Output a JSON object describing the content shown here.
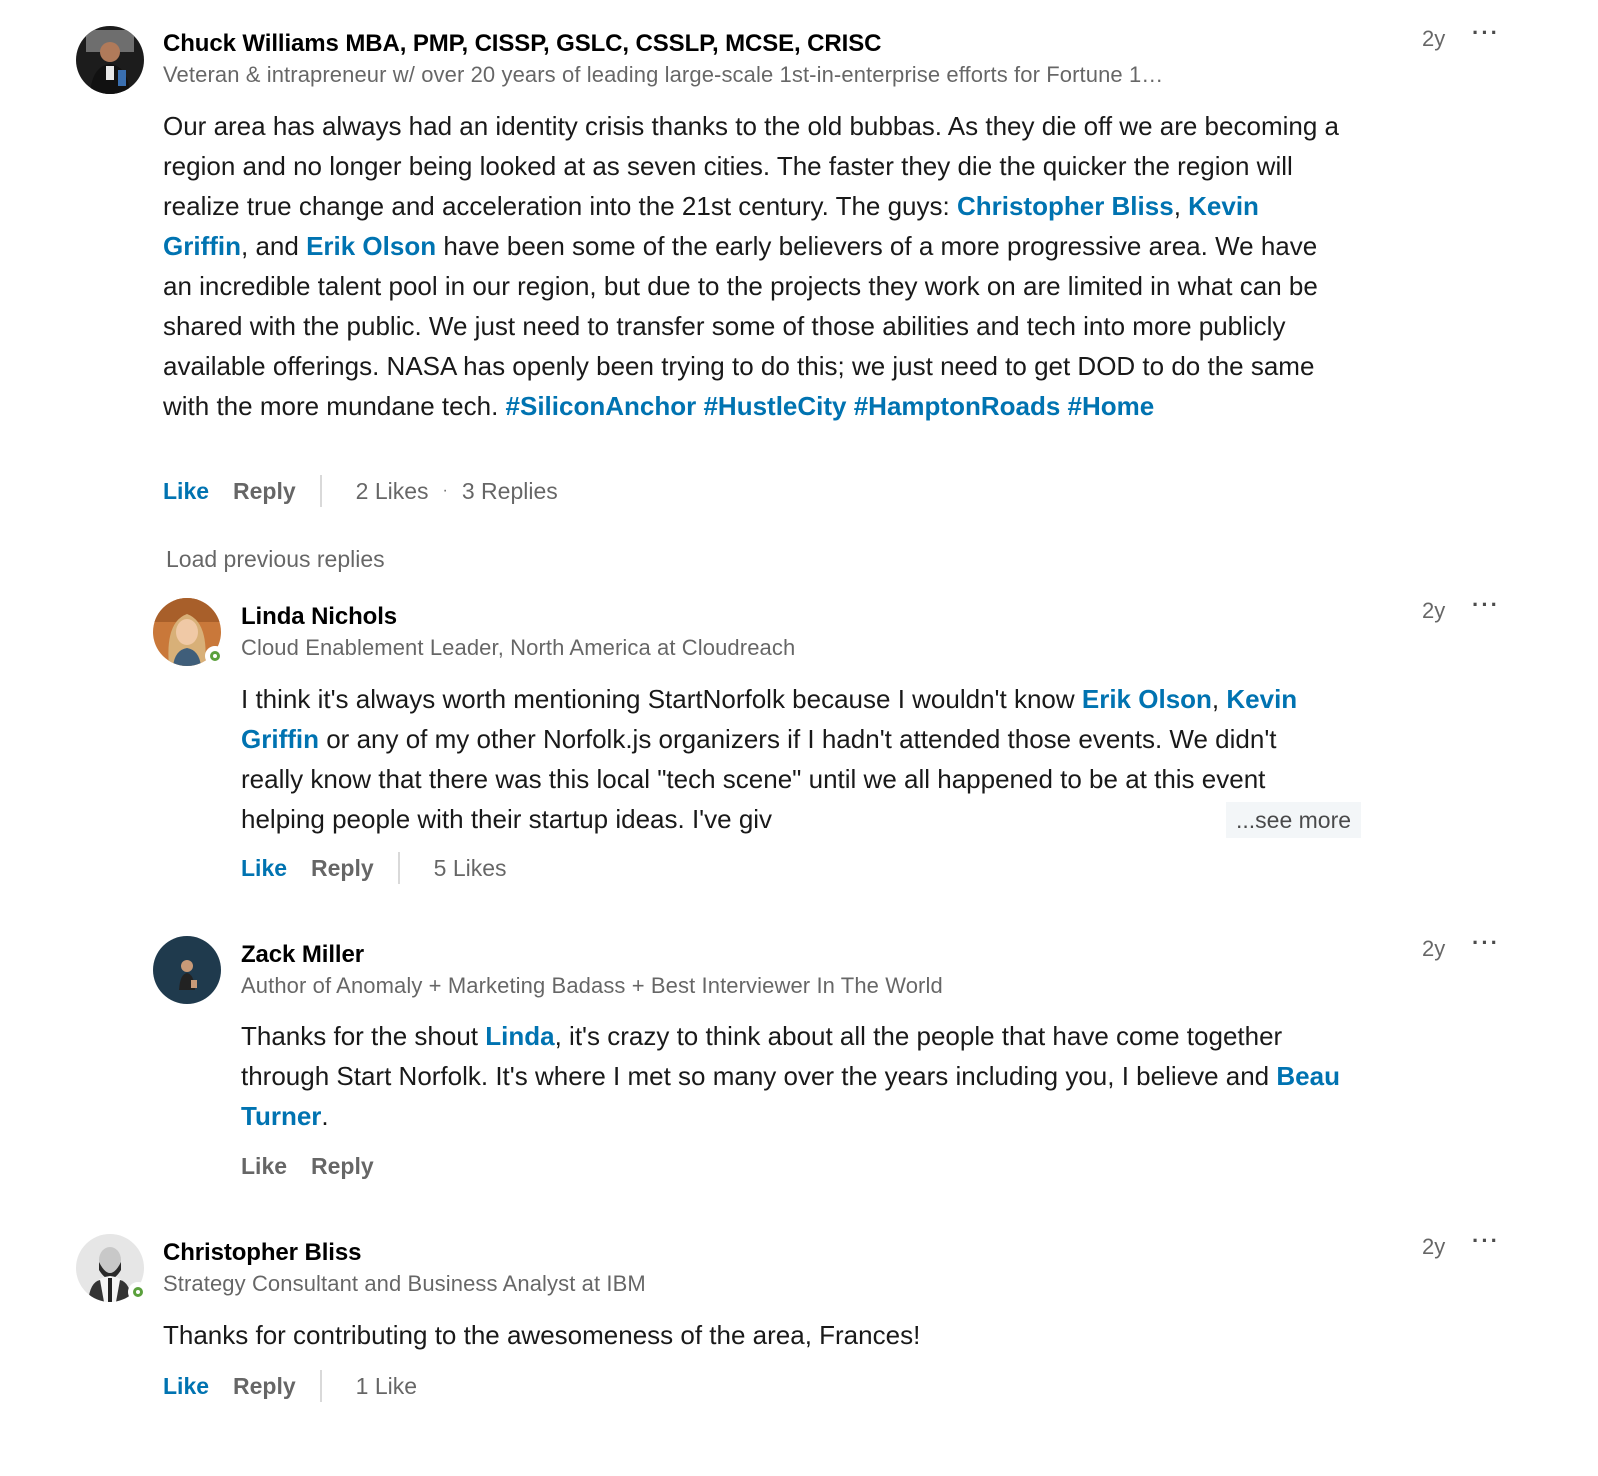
{
  "comments": [
    {
      "author": "Chuck Williams MBA, PMP, CISSP, GSLC, CSSLP, MCSE, CRISC",
      "headline": "Veteran & intrapreneur w/ over 20 years of leading large-scale 1st-in-enterprise efforts for Fortune 1…",
      "time": "2y",
      "more": "···",
      "body": {
        "t1": "Our area has always had an identity crisis thanks to the old bubbas.  As they die off we are becoming a region and no longer being looked at as seven cities.  The faster they die the quicker the region will realize true change and acceleration into the 21st century.  The guys: ",
        "m1": "Christopher Bliss",
        "t2": ", ",
        "m2": "Kevin Griffin",
        "t3": ", and ",
        "m3": "Erik Olson",
        "t4": " have been some of the early believers of a more progressive area.  We have an incredible talent pool in our region, but due to the projects they work on are limited in what can be shared with the public.  We just need to transfer some of those abilities and tech into more publicly available offerings.  NASA has openly been trying to do this; we just need to get DOD to do the same with the more mundane tech.  ",
        "tags": "#SiliconAnchor #HustleCity #HamptonRoads #Home"
      },
      "like": "Like",
      "reply": "Reply",
      "likes": "2 Likes",
      "dot": "·",
      "replies": "3 Replies"
    },
    {
      "author": "Linda Nichols",
      "headline": "Cloud Enablement Leader, North America at Cloudreach",
      "time": "2y",
      "more": "···",
      "body": {
        "t1": "I think it's always worth mentioning StartNorfolk because I wouldn't know ",
        "m1": "Erik Olson",
        "t2": ", ",
        "m2": "Kevin Griffin",
        "t3": " or any of my other Norfolk.js organizers if I hadn't attended those events. We didn't really know that there was this local \"tech scene\" until we all happened to be at this event helping people with their startup ideas. I've giv"
      },
      "see_more": "...see more",
      "like": "Like",
      "reply": "Reply",
      "likes": "5 Likes"
    },
    {
      "author": "Zack Miller",
      "headline": "Author of Anomaly + Marketing Badass + Best Interviewer In The World",
      "time": "2y",
      "more": "···",
      "body": {
        "t1": "Thanks for the shout ",
        "m1": "Linda",
        "t2": ", it's crazy to think about all the people that have come together through Start Norfolk. It's where I met so many over the years including you, I believe and ",
        "m2": "Beau Turner",
        "t3": "."
      },
      "like": "Like",
      "reply": "Reply"
    },
    {
      "author": "Christopher Bliss",
      "headline": "Strategy Consultant and Business Analyst at IBM",
      "time": "2y",
      "more": "···",
      "body": {
        "t1": "Thanks for contributing to the awesomeness of the area, Frances!"
      },
      "like": "Like",
      "reply": "Reply",
      "likes": "1 Like"
    }
  ],
  "load_previous": "Load previous replies",
  "colors": {
    "link": "#0073b1",
    "online": "#5aa03c",
    "muted": "rgba(0,0,0,0.6)"
  }
}
